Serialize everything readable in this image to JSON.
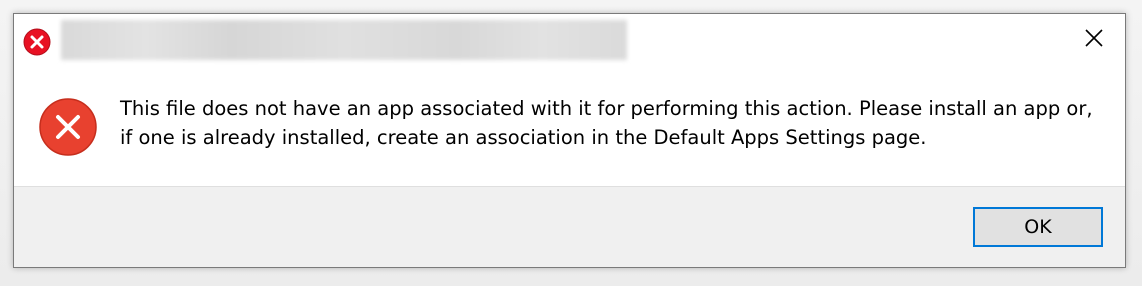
{
  "window": {
    "title": ""
  },
  "icons": {
    "title_icon": "error-icon",
    "body_icon": "error-icon",
    "close_icon": "close-icon"
  },
  "colors": {
    "error_red": "#e81123",
    "accent_blue": "#0078d7",
    "footer_bg": "#f0f0f0",
    "button_bg": "#e1e1e1"
  },
  "dialog": {
    "message": "This file does not have an app associated with it for performing this action. Please install an app or, if one is already installed, create an association in the Default Apps Settings page.",
    "ok_label": "OK"
  }
}
